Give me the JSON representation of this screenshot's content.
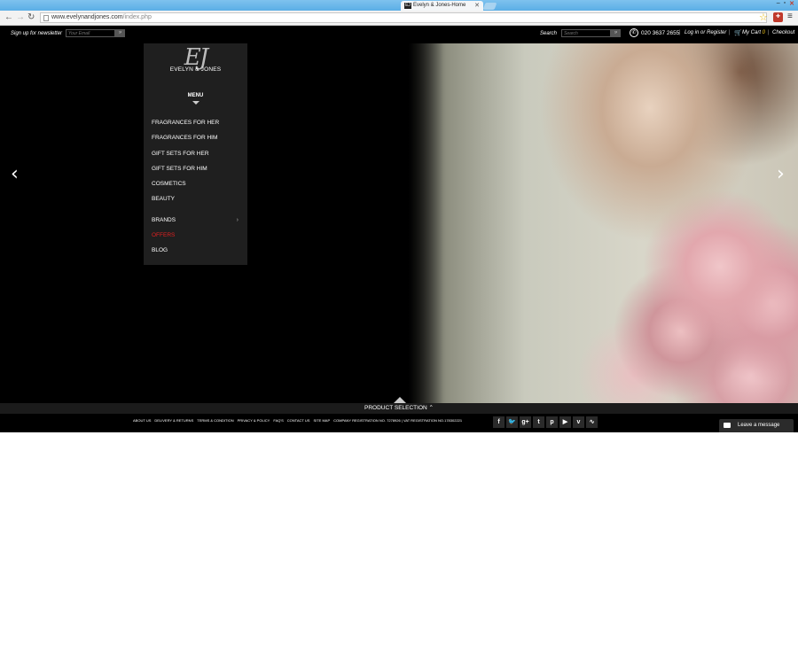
{
  "browser": {
    "tab_title": "Evelyn & Jones-Home",
    "tab_favicon": "EJ",
    "url_host": "www.evelynandjones.com",
    "url_path": "/index.php"
  },
  "topbar": {
    "newsletter_label": "Sign up for newsletter",
    "email_placeholder": "Your Email",
    "search_label": "Search",
    "search_placeholder": "Search",
    "phone": "020 3637 2655",
    "login_label": "Log in or Register",
    "cart_label": "My Cart",
    "cart_count": "0",
    "checkout_label": "Checkout"
  },
  "logo": {
    "monogram": "EJ",
    "brand": "EVELYN & JONES"
  },
  "menu": {
    "label": "MENU",
    "items": [
      {
        "label": "FRAGRANCES FOR HER"
      },
      {
        "label": "FRAGRANCES FOR HIM"
      },
      {
        "label": "GIFT SETS FOR HER"
      },
      {
        "label": "GIFT SETS FOR HIM"
      },
      {
        "label": "COSMETICS"
      },
      {
        "label": "BEAUTY"
      },
      {
        "label": "BRANDS"
      },
      {
        "label": "OFFERS"
      },
      {
        "label": "BLOG"
      }
    ]
  },
  "product_selection": "PRODUCT SELECTION ⌃",
  "footer": {
    "links": [
      "ABOUT US",
      "DELIVERY & RETURNS",
      "TERMS & CONDITION",
      "PRIVACY & POLICY",
      "FAQ'S",
      "CONTACT US",
      "SITE MAP",
      "COMPANY REGISTRATION NO. 7278926 | VAT REGISTRATION NO.178302221"
    ],
    "socials": [
      {
        "icon": "facebook-icon",
        "glyph": "f"
      },
      {
        "icon": "twitter-icon",
        "glyph": "🐦"
      },
      {
        "icon": "google-plus-icon",
        "glyph": "g+"
      },
      {
        "icon": "tumblr-icon",
        "glyph": "t"
      },
      {
        "icon": "pinterest-icon",
        "glyph": "p"
      },
      {
        "icon": "youtube-icon",
        "glyph": "▶"
      },
      {
        "icon": "vimeo-icon",
        "glyph": "v"
      },
      {
        "icon": "rss-icon",
        "glyph": "∿"
      }
    ]
  },
  "chat": {
    "label": "Leave a message"
  },
  "colors": {
    "offers": "#e02020",
    "cart_count": "#f0c419"
  }
}
